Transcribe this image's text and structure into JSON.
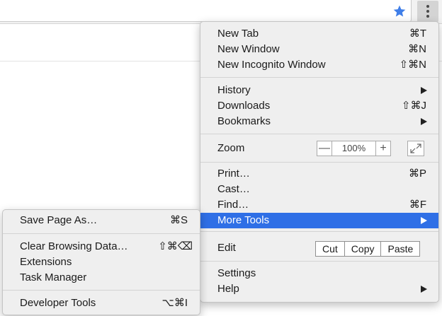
{
  "toolbar": {
    "star_icon": "star-icon",
    "menu_icon": "kebab-menu-icon",
    "accent": "#3f7ee8"
  },
  "menu": {
    "new_tab": {
      "label": "New Tab",
      "shortcut": "⌘T"
    },
    "new_window": {
      "label": "New Window",
      "shortcut": "⌘N"
    },
    "new_incognito": {
      "label": "New Incognito Window",
      "shortcut": "⇧⌘N"
    },
    "history": {
      "label": "History"
    },
    "downloads": {
      "label": "Downloads",
      "shortcut": "⇧⌘J"
    },
    "bookmarks": {
      "label": "Bookmarks"
    },
    "zoom": {
      "label": "Zoom",
      "minus": "—",
      "value": "100%",
      "plus": "+"
    },
    "print": {
      "label": "Print…",
      "shortcut": "⌘P"
    },
    "cast": {
      "label": "Cast…"
    },
    "find": {
      "label": "Find…",
      "shortcut": "⌘F"
    },
    "more_tools": {
      "label": "More Tools"
    },
    "edit": {
      "label": "Edit",
      "cut": "Cut",
      "copy": "Copy",
      "paste": "Paste"
    },
    "settings": {
      "label": "Settings"
    },
    "help": {
      "label": "Help"
    }
  },
  "submenu": {
    "save_page": {
      "label": "Save Page As…",
      "shortcut": "⌘S"
    },
    "clear_data": {
      "label": "Clear Browsing Data…",
      "shortcut": "⇧⌘⌫"
    },
    "extensions": {
      "label": "Extensions"
    },
    "task_manager": {
      "label": "Task Manager"
    },
    "dev_tools": {
      "label": "Developer Tools",
      "shortcut": "⌥⌘I"
    }
  },
  "colors": {
    "highlight": "#2f6fe6",
    "menu_bg": "#efefef"
  }
}
